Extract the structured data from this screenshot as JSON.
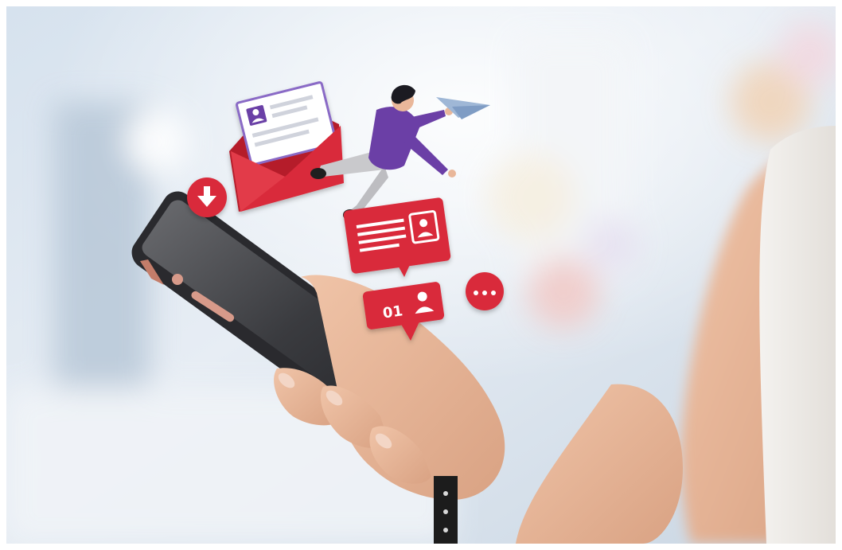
{
  "photo": {
    "subject": "hand-holding-smartphone",
    "background": "blurred-bokeh",
    "accent_color": "#d92b3a",
    "colors": {
      "red": "#d92b3a",
      "red_dark": "#b51f2c",
      "purple": "#6b3fa6",
      "phone_body": "#2a2a2e",
      "skin": "#e9b79a",
      "sky_blue": "#dfe8f1"
    }
  },
  "badges": {
    "counter_text": "01",
    "more_text": "•••"
  },
  "icons": [
    "envelope-icon",
    "download-icon",
    "paper-plane-icon",
    "chat-bubble-icon",
    "user-icon",
    "more-icon"
  ]
}
